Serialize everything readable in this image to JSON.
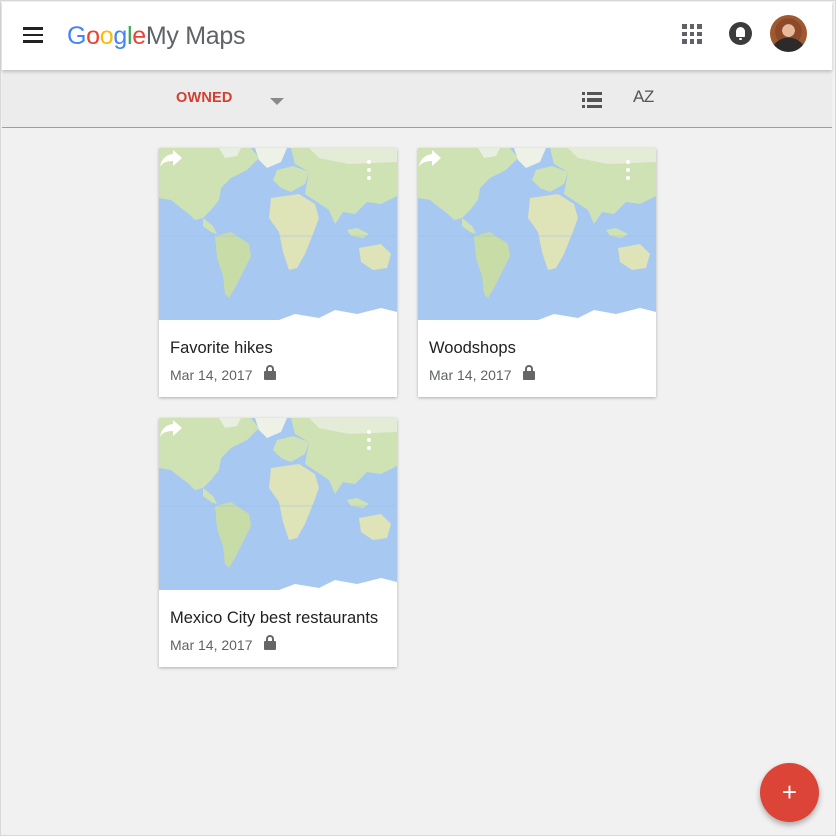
{
  "header": {
    "logo_google": [
      "G",
      "o",
      "o",
      "g",
      "l",
      "e"
    ],
    "logo_product": "My Maps",
    "menu_icon": "hamburger-menu-icon",
    "apps_icon": "apps-grid-icon",
    "notifications_icon": "notifications-bell-icon",
    "avatar_icon": "user-avatar"
  },
  "toolbar": {
    "filter_label": "OWNED",
    "filter_arrow_icon": "dropdown-arrow-icon",
    "view_icon": "list-view-icon",
    "sort_label": "AZ"
  },
  "colors": {
    "accent_red": "#d23f31",
    "fab_red": "#db4437",
    "ocean": "#a7c8f1",
    "land": "#cfe2b4"
  },
  "maps": [
    {
      "title": "Favorite hikes",
      "date": "Mar 14, 2017",
      "visibility_icon": "lock-icon"
    },
    {
      "title": "Woodshops",
      "date": "Mar 14, 2017",
      "visibility_icon": "lock-icon"
    },
    {
      "title": "Mexico City best restaurants",
      "date": "Mar 14, 2017",
      "visibility_icon": "lock-icon"
    }
  ],
  "fab": {
    "label": "+"
  }
}
